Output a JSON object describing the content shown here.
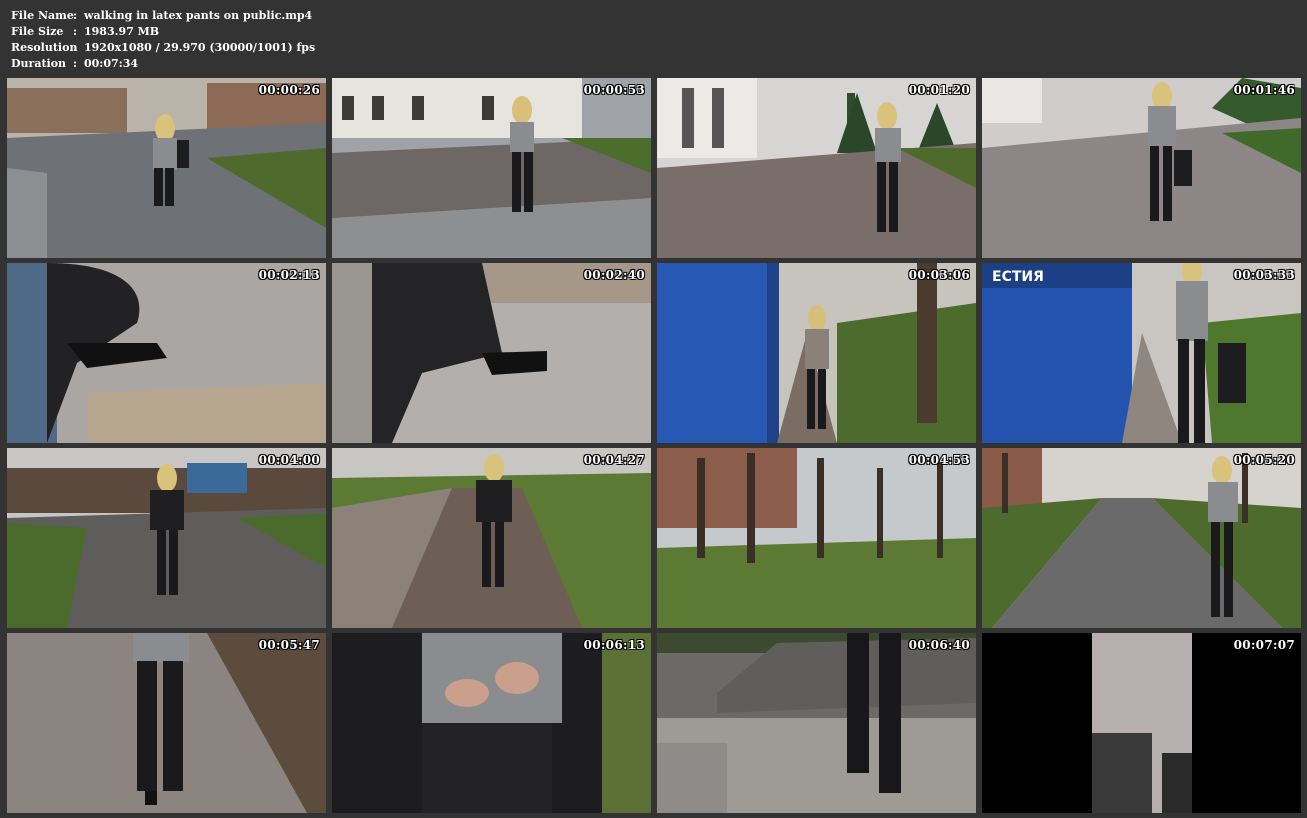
{
  "info": {
    "rows": [
      {
        "key": "File Name",
        "value": "walking in latex pants on public.mp4"
      },
      {
        "key": "File Size",
        "value": "1983.97 MB"
      },
      {
        "key": "Resolution",
        "value": "1920x1080 / 29.970 (30000/1001) fps"
      },
      {
        "key": "Duration",
        "value": "00:07:34"
      }
    ],
    "separator": ":"
  },
  "thumbnails": [
    {
      "timestamp": "00:00:26",
      "scene": "woman walking on paved park path",
      "image_text": ""
    },
    {
      "timestamp": "00:00:53",
      "scene": "woman walking on cobblestone road by white building",
      "image_text": ""
    },
    {
      "timestamp": "00:01:20",
      "scene": "woman walking away on cobblestone street",
      "image_text": ""
    },
    {
      "timestamp": "00:01:46",
      "scene": "woman walking on cobblestone path in park",
      "image_text": ""
    },
    {
      "timestamp": "00:02:13",
      "scene": "feet close-up on stone pavement",
      "image_text": ""
    },
    {
      "timestamp": "00:02:40",
      "scene": "feet close-up on stone pavement",
      "image_text": ""
    },
    {
      "timestamp": "00:03:06",
      "scene": "woman walking beside blue train car",
      "image_text": ""
    },
    {
      "timestamp": "00:03:33",
      "scene": "woman walking beside blue train car",
      "image_text": "ЕСТИЯ"
    },
    {
      "timestamp": "00:04:00",
      "scene": "woman walking toward camera in park",
      "image_text": ""
    },
    {
      "timestamp": "00:04:27",
      "scene": "woman walking on dirt path in park",
      "image_text": ""
    },
    {
      "timestamp": "00:04:53",
      "scene": "bare trees and grass in park",
      "image_text": ""
    },
    {
      "timestamp": "00:05:20",
      "scene": "woman walking on tree-lined path",
      "image_text": ""
    },
    {
      "timestamp": "00:05:47",
      "scene": "legs close-up on asphalt path",
      "image_text": ""
    },
    {
      "timestamp": "00:06:13",
      "scene": "hands unbuttoning coat close-up",
      "image_text": ""
    },
    {
      "timestamp": "00:06:40",
      "scene": "legs on stone stairs",
      "image_text": ""
    },
    {
      "timestamp": "00:07:07",
      "scene": "vertical video of feet on tiled floor",
      "image_text": ""
    }
  ],
  "colors": {
    "background": "#333333",
    "text": "#ffffff",
    "timestamp_outline": "#000000"
  }
}
